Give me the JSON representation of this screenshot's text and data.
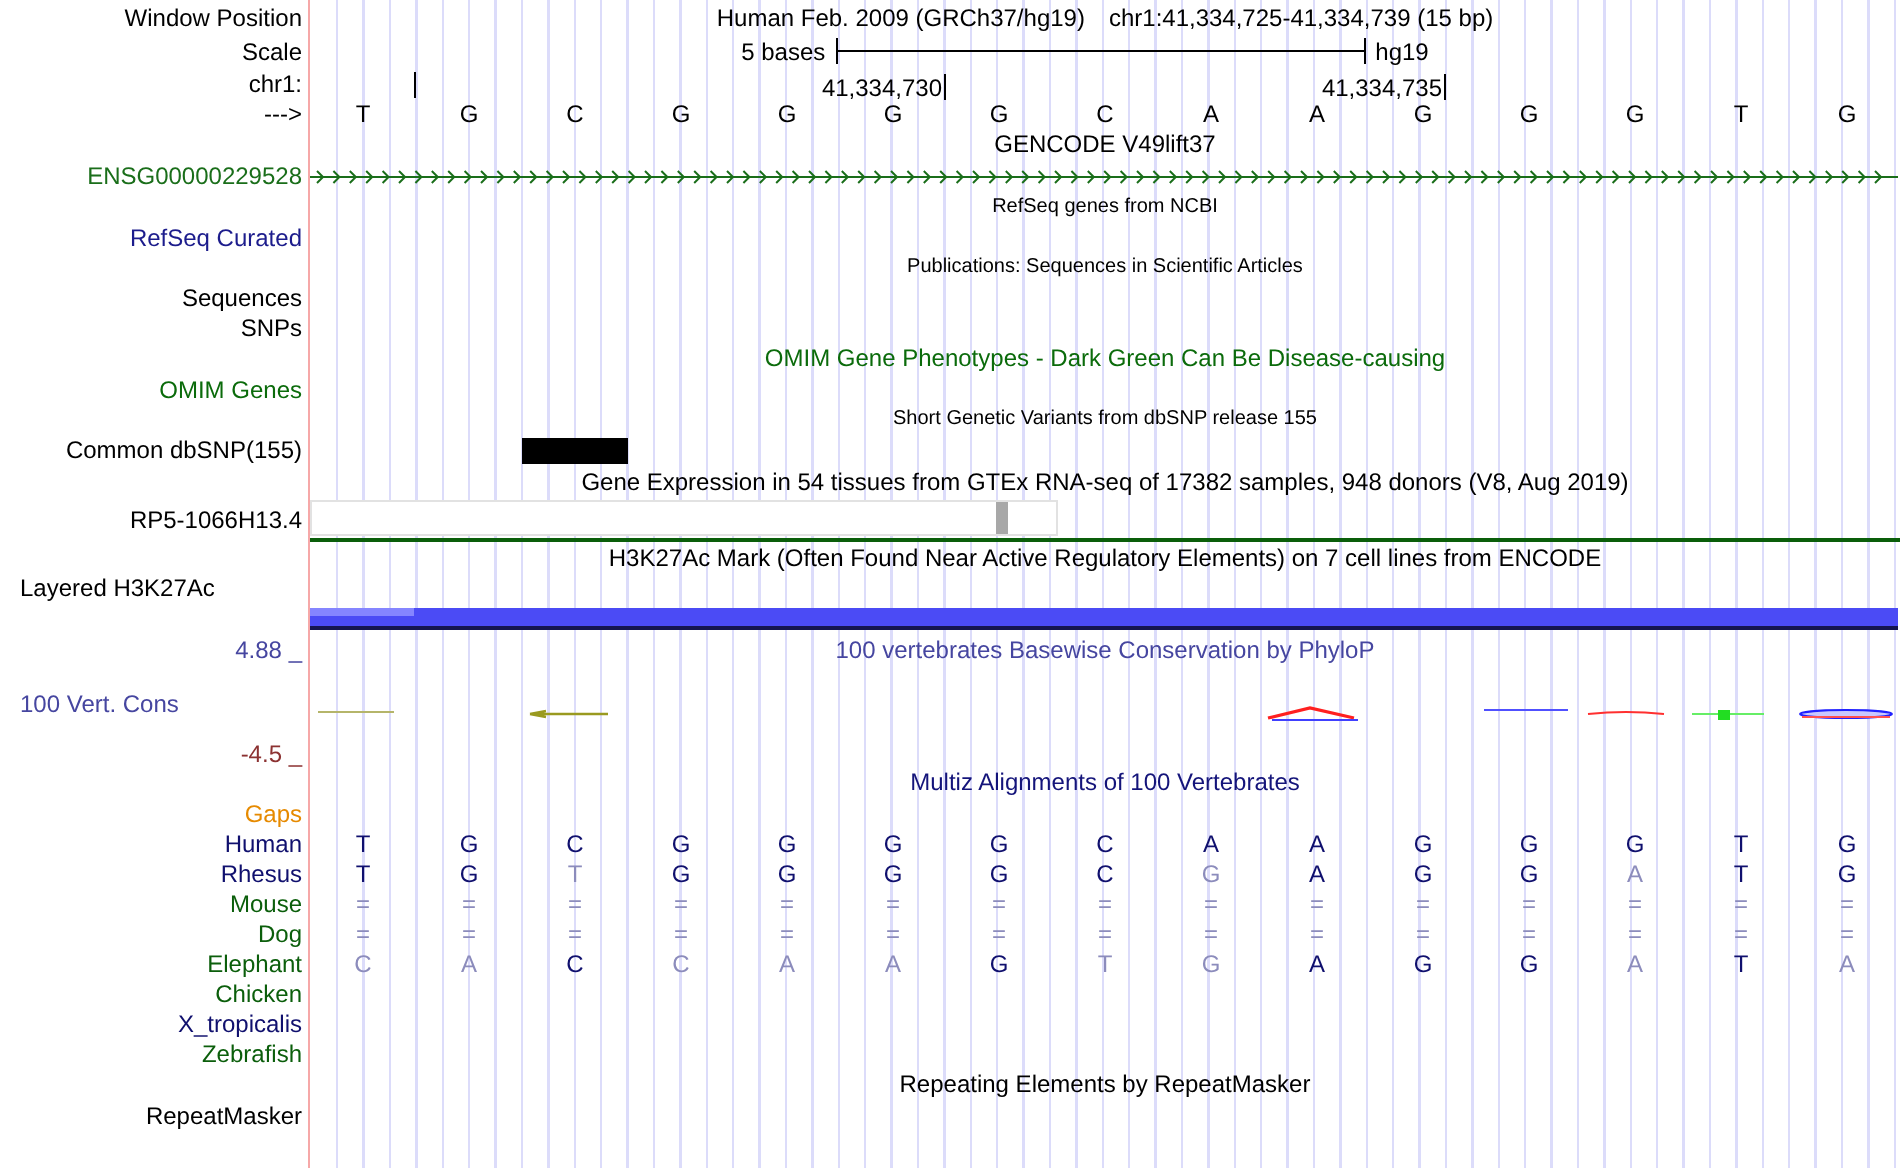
{
  "header": {
    "position_label": "Window Position",
    "title": "Human Feb. 2009 (GRCh37/hg19)",
    "position": "chr1:41,334,725-41,334,739 (15 bp)",
    "scale_label": "Scale",
    "scale_text": "5 bases",
    "assembly": "hg19",
    "chrom_label": "chr1:",
    "ticks": [
      "41,334,730",
      "41,334,735"
    ],
    "strand": "--->",
    "bases": [
      "T",
      "G",
      "C",
      "G",
      "G",
      "G",
      "G",
      "C",
      "A",
      "A",
      "G",
      "G",
      "G",
      "T",
      "G"
    ]
  },
  "rows": [
    {
      "kind": "title",
      "text": "GENCODE V49lift37",
      "color": "#000000"
    },
    {
      "kind": "gene",
      "label": "ENSG00000229528",
      "color": "#1a6e1a"
    },
    {
      "kind": "caption",
      "text": "RefSeq genes from NCBI",
      "color": "#000000"
    },
    {
      "kind": "label",
      "text": "RefSeq Curated",
      "color": "#1c1c8c"
    },
    {
      "kind": "caption",
      "text": "Publications: Sequences in Scientific Articles",
      "color": "#000000"
    },
    {
      "kind": "label",
      "text": "Sequences",
      "color": "#000000"
    },
    {
      "kind": "label",
      "text": "SNPs",
      "color": "#000000"
    },
    {
      "kind": "title",
      "text": "OMIM Gene Phenotypes - Dark Green Can Be Disease-causing",
      "color": "#0b6b0b"
    },
    {
      "kind": "label",
      "text": "OMIM Genes",
      "color": "#0b6b0b"
    },
    {
      "kind": "caption",
      "text": "Short Genetic Variants from dbSNP release 155",
      "color": "#000000"
    },
    {
      "kind": "snp",
      "label": "Common dbSNP(155)",
      "color": "#000000"
    },
    {
      "kind": "title",
      "text": "Gene Expression in 54 tissues from GTEx RNA-seq of 17382 samples, 948 donors (V8, Aug 2019)",
      "color": "#000000"
    },
    {
      "kind": "expression",
      "label": "RP5-1066H13.4",
      "color": "#000000"
    },
    {
      "kind": "title",
      "text": "H3K27Ac Mark (Often Found Near Active Regulatory Elements) on 7 cell lines from ENCODE",
      "color": "#000000"
    },
    {
      "kind": "signal",
      "label": "Layered H3K27Ac",
      "color": "#000000"
    },
    {
      "kind": "phylop",
      "title": "100 vertebrates Basewise Conservation by PhyloP",
      "max": "4.88 _",
      "label": "100 Vert. Cons",
      "min": "-4.5 _",
      "color": "#4646a0"
    },
    {
      "kind": "title",
      "text": "Multiz Alignments of 100 Vertebrates",
      "color": "#14147a"
    },
    {
      "kind": "label",
      "text": "Gaps",
      "color": "#e68a00"
    },
    {
      "kind": "species",
      "label": "Human",
      "color": "#10106e",
      "bases": [
        "T",
        "G",
        "C",
        "G",
        "G",
        "G",
        "G",
        "C",
        "A",
        "A",
        "G",
        "G",
        "G",
        "T",
        "G"
      ],
      "matches": [
        true,
        true,
        true,
        true,
        true,
        true,
        true,
        true,
        true,
        true,
        true,
        true,
        true,
        true,
        true
      ]
    },
    {
      "kind": "species",
      "label": "Rhesus",
      "color": "#10106e",
      "bases": [
        "T",
        "G",
        "T",
        "G",
        "G",
        "G",
        "G",
        "C",
        "G",
        "A",
        "G",
        "G",
        "A",
        "T",
        "G"
      ],
      "matches": [
        true,
        true,
        false,
        true,
        true,
        true,
        true,
        true,
        false,
        true,
        true,
        true,
        false,
        true,
        true
      ]
    },
    {
      "kind": "species",
      "label": "Mouse",
      "color": "#0b5e0b",
      "bases": [
        "=",
        "=",
        "=",
        "=",
        "=",
        "=",
        "=",
        "=",
        "=",
        "=",
        "=",
        "=",
        "=",
        "=",
        "="
      ],
      "matches": [
        false,
        false,
        false,
        false,
        false,
        false,
        false,
        false,
        false,
        false,
        false,
        false,
        false,
        false,
        false
      ]
    },
    {
      "kind": "species",
      "label": "Dog",
      "color": "#0b5e0b",
      "bases": [
        "=",
        "=",
        "=",
        "=",
        "=",
        "=",
        "=",
        "=",
        "=",
        "=",
        "=",
        "=",
        "=",
        "=",
        "="
      ],
      "matches": [
        false,
        false,
        false,
        false,
        false,
        false,
        false,
        false,
        false,
        false,
        false,
        false,
        false,
        false,
        false
      ]
    },
    {
      "kind": "species",
      "label": "Elephant",
      "color": "#0b5e0b",
      "bases": [
        "C",
        "A",
        "C",
        "C",
        "A",
        "A",
        "G",
        "T",
        "G",
        "A",
        "G",
        "G",
        "A",
        "T",
        "A"
      ],
      "matches": [
        false,
        false,
        true,
        false,
        false,
        false,
        true,
        false,
        false,
        true,
        true,
        true,
        false,
        true,
        false
      ]
    },
    {
      "kind": "species",
      "label": "Chicken",
      "color": "#0b5e0b"
    },
    {
      "kind": "species",
      "label": "X_tropicalis",
      "color": "#10106e"
    },
    {
      "kind": "species",
      "label": "Zebrafish",
      "color": "#0b5e0b"
    },
    {
      "kind": "title",
      "text": "Repeating Elements by RepeatMasker",
      "color": "#000000"
    },
    {
      "kind": "label",
      "text": "RepeatMasker",
      "color": "#000000"
    }
  ]
}
